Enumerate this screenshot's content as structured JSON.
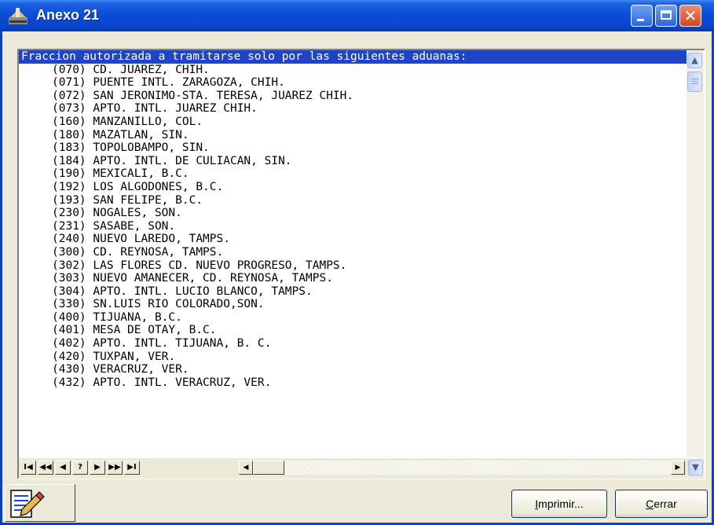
{
  "window": {
    "title": "Anexo 21"
  },
  "listbox": {
    "header": "Fraccion autorizada a tramitarse solo por las siguientes aduanas:",
    "rows": [
      "(070) CD. JUAREZ, CHIH.",
      "(071) PUENTE INTL. ZARAGOZA, CHIH.",
      "(072) SAN JERONIMO-STA. TERESA, JUAREZ CHIH.",
      "(073) APTO. INTL. JUAREZ CHIH.",
      "(160) MANZANILLO, COL.",
      "(180) MAZATLAN, SIN.",
      "(183) TOPOLOBAMPO, SIN.",
      "(184) APTO. INTL. DE CULIACAN, SIN.",
      "(190) MEXICALI, B.C.",
      "(192) LOS ALGODONES, B.C.",
      "(193) SAN FELIPE, B.C.",
      "(230) NOGALES, SON.",
      "(231) SASABE, SON.",
      "(240) NUEVO LAREDO, TAMPS.",
      "(300) CD. REYNOSA, TAMPS.",
      "(302) LAS FLORES CD. NUEVO PROGRESO, TAMPS.",
      "(303) NUEVO AMANECER, CD. REYNOSA, TAMPS.",
      "(304) APTO. INTL. LUCIO BLANCO, TAMPS.",
      "(330) SN.LUIS RIO COLORADO,SON.",
      "(400) TIJUANA, B.C.",
      "(401) MESA DE OTAY, B.C.",
      "(402) APTO. INTL. TIJUANA, B. C.",
      "(420) TUXPAN, VER.",
      "(430) VERACRUZ, VER.",
      "(432) APTO. INTL. VERACRUZ, VER."
    ]
  },
  "nav": {
    "first": "I◀",
    "prev_page": "◀◀",
    "prev": "◀",
    "help": "?",
    "next": "▶",
    "next_page": "▶▶",
    "last": "▶I"
  },
  "buttons": {
    "print_accel": "I",
    "print_rest": "mprimir...",
    "close_accel": "C",
    "close_rest": "errar"
  },
  "colors": {
    "titlebar": "#0a4bd6",
    "selection": "#1f44c6",
    "face": "#ece9d8"
  }
}
